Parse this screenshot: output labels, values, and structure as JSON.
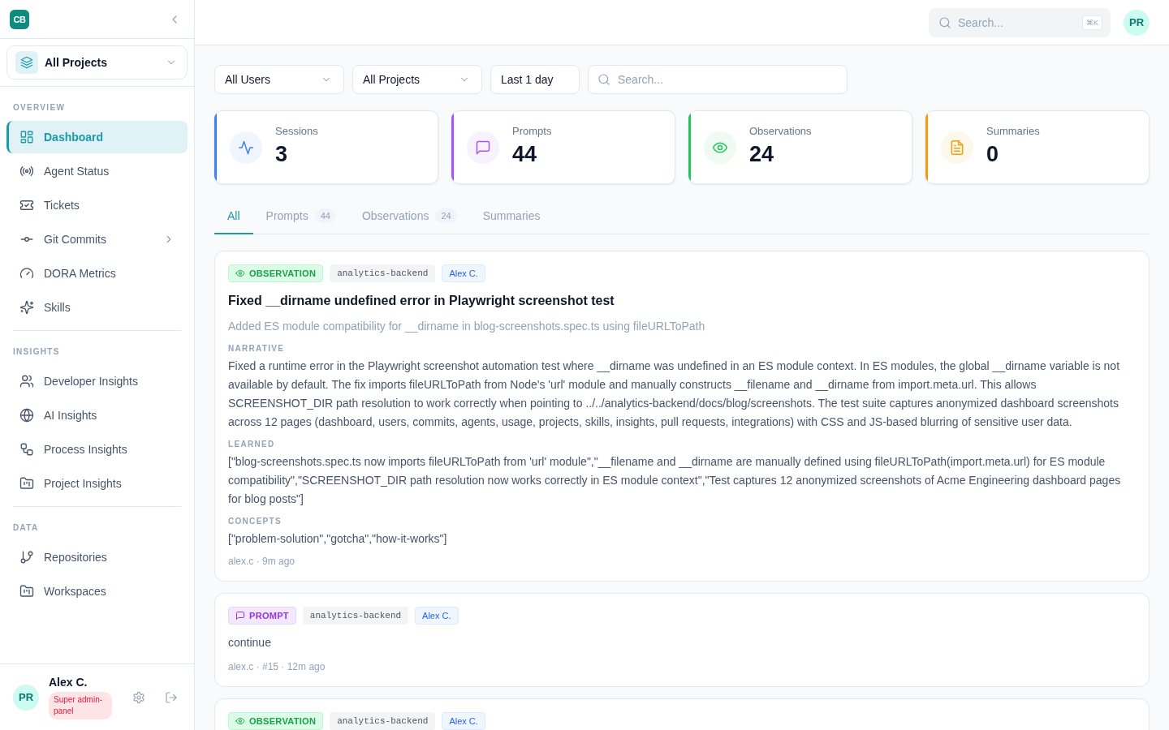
{
  "sidebar": {
    "logo": "CB",
    "project_selector": {
      "label": "All Projects"
    },
    "sections": [
      {
        "title": "OVERVIEW",
        "items": [
          {
            "label": "Dashboard",
            "selected": true,
            "has_submenu": false
          },
          {
            "label": "Agent Status",
            "selected": false,
            "has_submenu": false
          },
          {
            "label": "Tickets",
            "selected": false,
            "has_submenu": false
          },
          {
            "label": "Git Commits",
            "selected": false,
            "has_submenu": true
          },
          {
            "label": "DORA Metrics",
            "selected": false,
            "has_submenu": false
          },
          {
            "label": "Skills",
            "selected": false,
            "has_submenu": false
          }
        ]
      },
      {
        "title": "INSIGHTS",
        "items": [
          {
            "label": "Developer Insights",
            "selected": false,
            "has_submenu": false
          },
          {
            "label": "AI Insights",
            "selected": false,
            "has_submenu": false
          },
          {
            "label": "Process Insights",
            "selected": false,
            "has_submenu": false
          },
          {
            "label": "Project Insights",
            "selected": false,
            "has_submenu": false
          }
        ]
      },
      {
        "title": "DATA",
        "items": [
          {
            "label": "Repositories",
            "selected": false,
            "has_submenu": false
          },
          {
            "label": "Workspaces",
            "selected": false,
            "has_submenu": false
          }
        ]
      }
    ],
    "user": {
      "avatar": "PR",
      "name": "Alex C.",
      "role": "Super admin-panel"
    }
  },
  "header": {
    "search": {
      "placeholder": "Search...",
      "shortcut": "⌘K"
    },
    "avatar": "PR"
  },
  "filters": [
    {
      "kind": "select",
      "value": "All Users"
    },
    {
      "kind": "select",
      "value": "All Projects"
    },
    {
      "kind": "button",
      "value": "Last 1 day"
    },
    {
      "kind": "search",
      "placeholder": "Search..."
    }
  ],
  "stats": [
    {
      "label": "Sessions",
      "value": "3",
      "color": "#3b82f6"
    },
    {
      "label": "Prompts",
      "value": "44",
      "color": "#a855f7"
    },
    {
      "label": "Observations",
      "value": "24",
      "color": "#22c55e"
    },
    {
      "label": "Summaries",
      "value": "0",
      "color": "#f59e0b"
    }
  ],
  "tabs": [
    {
      "label": "All",
      "selected": true
    },
    {
      "label": "Prompts",
      "count": "44",
      "selected": false
    },
    {
      "label": "Observations",
      "count": "24",
      "selected": false
    },
    {
      "label": "Summaries",
      "selected": false
    }
  ],
  "feed": [
    {
      "kind": "observation",
      "type_label": "OBSERVATION",
      "project": "analytics-backend",
      "user": "Alex C.",
      "title": "Fixed __dirname undefined error in Playwright screenshot test",
      "summary": "Added ES module compatibility for __dirname in blog-screenshots.spec.ts using fileURLToPath",
      "sections": [
        {
          "label": "NARRATIVE",
          "text": "Fixed a runtime error in the Playwright screenshot automation test where __dirname was undefined in an ES module context. In ES modules, the global __dirname variable is not available by default. The fix imports fileURLToPath from Node's 'url' module and manually constructs __filename and __dirname from import.meta.url. This allows SCREENSHOT_DIR path resolution to work correctly when pointing to ../../analytics-backend/docs/blog/screenshots. The test suite captures anonymized dashboard screenshots across 12 pages (dashboard, users, commits, agents, usage, projects, skills, insights, pull requests, integrations) with CSS and JS-based blurring of sensitive user data."
        },
        {
          "label": "LEARNED",
          "text": "[\"blog-screenshots.spec.ts now imports fileURLToPath from 'url' module\",\"__filename and __dirname are manually defined using fileURLToPath(import.meta.url) for ES module compatibility\",\"SCREENSHOT_DIR path resolution now works correctly in ES module context\",\"Test captures 12 anonymized screenshots of Acme Engineering dashboard pages for blog posts\"]"
        },
        {
          "label": "CONCEPTS",
          "text": "[\"problem-solution\",\"gotcha\",\"how-it-works\"]"
        }
      ],
      "meta": "alex.c · 9m ago"
    },
    {
      "kind": "prompt",
      "type_label": "PROMPT",
      "project": "analytics-backend",
      "user": "Alex C.",
      "body": "continue",
      "meta": "alex.c · #15 · 12m ago"
    },
    {
      "kind": "observation",
      "type_label": "OBSERVATION",
      "project": "analytics-backend",
      "user": "Alex C."
    }
  ]
}
